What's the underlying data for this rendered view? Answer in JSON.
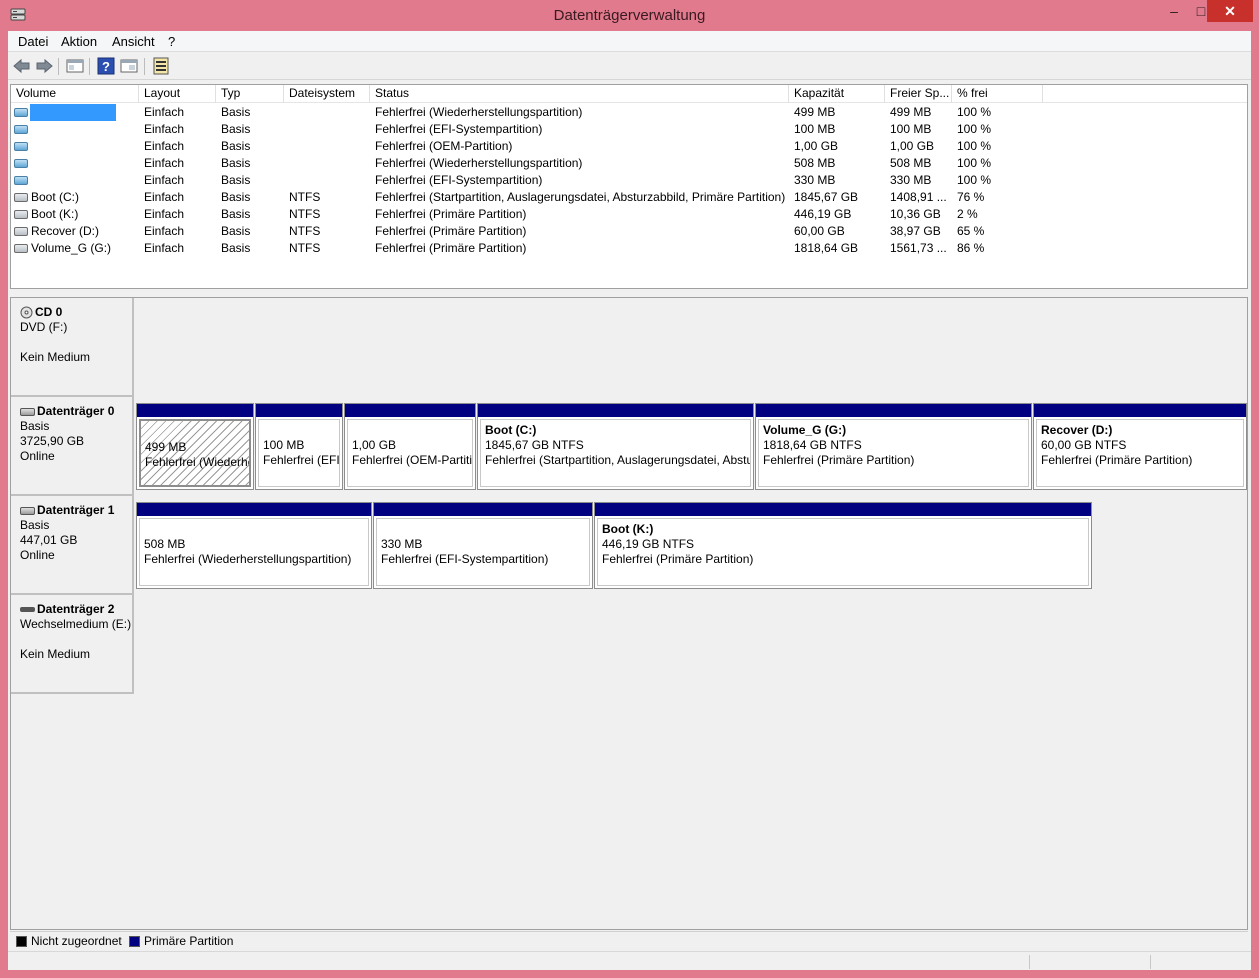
{
  "window": {
    "title": "Datenträgerverwaltung",
    "minimize": "–",
    "maximize": "□",
    "close": "✕"
  },
  "menu": [
    "Datei",
    "Aktion",
    "Ansicht",
    "?"
  ],
  "toolbar": {
    "icons": [
      "back-icon",
      "forward-icon",
      "console-tree-icon",
      "help-icon",
      "properties-icon",
      "disk-settings-icon"
    ]
  },
  "volume_list": {
    "columns": [
      "Volume",
      "Layout",
      "Typ",
      "Dateisystem",
      "Status",
      "Kapazität",
      "Freier Sp...",
      "% frei"
    ],
    "rows": [
      {
        "volume": "",
        "layout": "Einfach",
        "typ": "Basis",
        "fs": "",
        "status": "Fehlerfrei (Wiederherstellungspartition)",
        "cap": "499 MB",
        "free": "499 MB",
        "pct": "100 %",
        "selected": true
      },
      {
        "volume": "",
        "layout": "Einfach",
        "typ": "Basis",
        "fs": "",
        "status": "Fehlerfrei (EFI-Systempartition)",
        "cap": "100 MB",
        "free": "100 MB",
        "pct": "100 %"
      },
      {
        "volume": "",
        "layout": "Einfach",
        "typ": "Basis",
        "fs": "",
        "status": "Fehlerfrei (OEM-Partition)",
        "cap": "1,00 GB",
        "free": "1,00 GB",
        "pct": "100 %"
      },
      {
        "volume": "",
        "layout": "Einfach",
        "typ": "Basis",
        "fs": "",
        "status": "Fehlerfrei (Wiederherstellungspartition)",
        "cap": "508 MB",
        "free": "508 MB",
        "pct": "100 %"
      },
      {
        "volume": "",
        "layout": "Einfach",
        "typ": "Basis",
        "fs": "",
        "status": "Fehlerfrei (EFI-Systempartition)",
        "cap": "330 MB",
        "free": "330 MB",
        "pct": "100 %"
      },
      {
        "volume": "Boot (C:)",
        "layout": "Einfach",
        "typ": "Basis",
        "fs": "NTFS",
        "status": "Fehlerfrei (Startpartition, Auslagerungsdatei, Absturzabbild, Primäre Partition)",
        "cap": "1845,67 GB",
        "free": "1408,91 ...",
        "pct": "76 %"
      },
      {
        "volume": "Boot (K:)",
        "layout": "Einfach",
        "typ": "Basis",
        "fs": "NTFS",
        "status": "Fehlerfrei (Primäre Partition)",
        "cap": "446,19 GB",
        "free": "10,36 GB",
        "pct": "2 %"
      },
      {
        "volume": "Recover (D:)",
        "layout": "Einfach",
        "typ": "Basis",
        "fs": "NTFS",
        "status": "Fehlerfrei (Primäre Partition)",
        "cap": "60,00 GB",
        "free": "38,97 GB",
        "pct": "65 %"
      },
      {
        "volume": "Volume_G (G:)",
        "layout": "Einfach",
        "typ": "Basis",
        "fs": "NTFS",
        "status": "Fehlerfrei (Primäre Partition)",
        "cap": "1818,64 GB",
        "free": "1561,73 ...",
        "pct": "86 %"
      }
    ]
  },
  "disks": [
    {
      "name": "CD 0",
      "lines": [
        "DVD (F:)",
        "",
        "Kein Medium"
      ]
    },
    {
      "name": "Datenträger 0",
      "lines": [
        "Basis",
        "3725,90 GB",
        "Online"
      ],
      "partitions": [
        {
          "title": "",
          "size": "499 MB",
          "status": "Fehlerfrei (Wiederherstellungspartition)"
        },
        {
          "title": "",
          "size": "100 MB",
          "status": "Fehlerfrei (EFI-Systempartition)"
        },
        {
          "title": "",
          "size": "1,00 GB",
          "status": "Fehlerfrei (OEM-Partition)"
        },
        {
          "title": "Boot  (C:)",
          "size": "1845,67 GB NTFS",
          "status": "Fehlerfrei (Startpartition, Auslagerungsdatei, Absturzabbild, Primäre Partition)"
        },
        {
          "title": "Volume_G  (G:)",
          "size": "1818,64 GB NTFS",
          "status": "Fehlerfrei (Primäre Partition)"
        },
        {
          "title": "Recover  (D:)",
          "size": "60,00 GB NTFS",
          "status": "Fehlerfrei (Primäre Partition)"
        }
      ]
    },
    {
      "name": "Datenträger 1",
      "lines": [
        "Basis",
        "447,01 GB",
        "Online"
      ],
      "partitions": [
        {
          "title": "",
          "size": "508 MB",
          "status": "Fehlerfrei (Wiederherstellungspartition)"
        },
        {
          "title": "",
          "size": "330 MB",
          "status": "Fehlerfrei (EFI-Systempartition)"
        },
        {
          "title": "Boot  (K:)",
          "size": "446,19 GB NTFS",
          "status": "Fehlerfrei (Primäre Partition)"
        }
      ]
    },
    {
      "name": "Datenträger 2",
      "lines": [
        "Wechselmedium (E:)",
        "",
        "Kein Medium"
      ]
    }
  ],
  "legend": [
    {
      "label": "Nicht zugeordnet",
      "color": "#000000"
    },
    {
      "label": "Primäre Partition",
      "color": "#000080"
    }
  ],
  "colors": {
    "window_frame": "#e07a8c",
    "partition_bar": "#000080",
    "selection": "#3399ff"
  }
}
